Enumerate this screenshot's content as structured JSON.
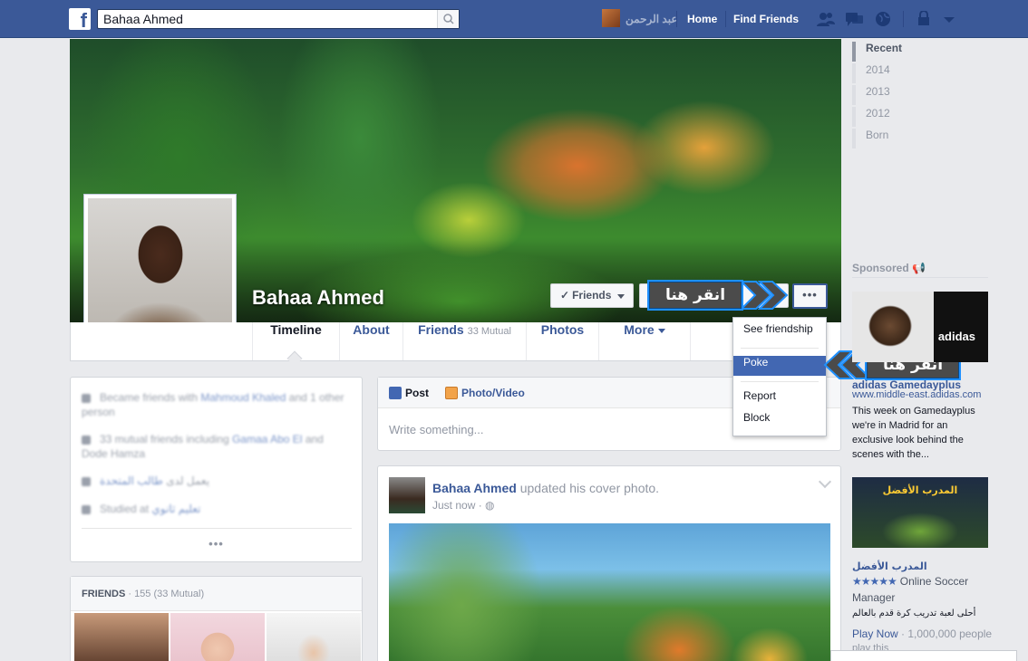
{
  "topbar": {
    "search_value": "Bahaa Ahmed",
    "user_name": "عبد الرحمن",
    "home_label": "Home",
    "find_friends_label": "Find Friends"
  },
  "profile": {
    "name": "Bahaa Ahmed",
    "friends_button_label": "Friends",
    "more_button_label": "•••"
  },
  "callouts": {
    "first_label": "انقر هنا",
    "second_label": "انقر هنا"
  },
  "dropdown": {
    "items": [
      "See friendship",
      "Poke",
      "Report",
      "Block"
    ],
    "highlighted": "Poke"
  },
  "nav": {
    "timeline_label": "Timeline",
    "about_label": "About",
    "friends_label": "Friends",
    "friends_mutual": "33 Mutual",
    "photos_label": "Photos",
    "more_label": "More"
  },
  "intro": {
    "rows": [
      {
        "text": "Became friends with ",
        "link": "Mahmoud Khaled",
        "rest": " and 1 other person"
      },
      {
        "text": "33 mutual friends including ",
        "link": "Gamaa Abo El",
        "rest": " and Dode Hamza"
      },
      {
        "text": "يعمل لدى ",
        "link": "طالب المتحدة",
        "rest": ""
      },
      {
        "text": "Studied at ",
        "link": "تعليم ثانوي",
        "rest": ""
      }
    ],
    "more_label": "•••"
  },
  "friends_box": {
    "title": "FRIENDS",
    "count": "· 155 (33 Mutual)"
  },
  "composer": {
    "post_label": "Post",
    "photo_label": "Photo/Video",
    "placeholder": "Write something..."
  },
  "post": {
    "author": "Bahaa Ahmed",
    "action": " updated his cover photo.",
    "time": "Just now · "
  },
  "years": {
    "items": [
      "Recent",
      "2014",
      "2013",
      "2012",
      "Born"
    ]
  },
  "sponsored": {
    "label": "Sponsored",
    "ad1": {
      "brand_logo": "adidas",
      "title": "adidas Gamedayplus",
      "url": "www.middle-east.adidas.com",
      "text": "This week on Gamedayplus we're in Madrid for an exclusive look behind the scenes with the..."
    },
    "ad2": {
      "image_title": "المدرب الأفضل",
      "title": "المدرب الأفضل",
      "stars": "★★★★★",
      "rating_text": "Online Soccer",
      "sub": "Manager",
      "arabic_text": "أحلى لعبة تدريب كرة قدم بالعالم",
      "cta": "Play Now",
      "cta_rest": " · 1,000,000 people",
      "cta_line2": "play this"
    }
  },
  "colors": {
    "brand": "#3b5998",
    "highlight": "#4267b2",
    "callout_border": "#1e90ff"
  }
}
